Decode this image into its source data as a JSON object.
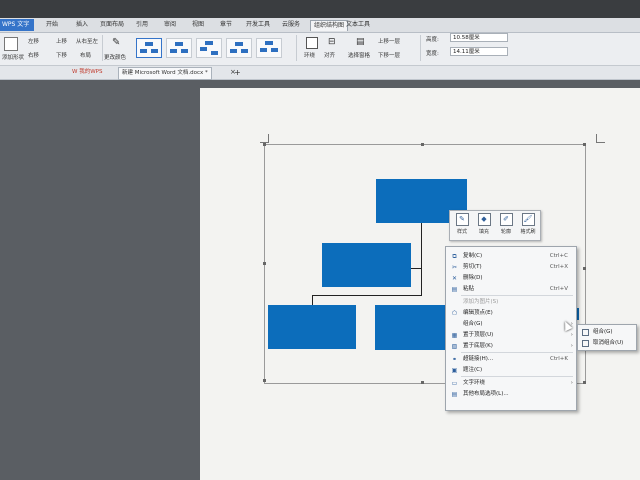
{
  "app": {
    "name": "WPS 文字"
  },
  "tabs": [
    "开始",
    "插入",
    "页面布局",
    "引用",
    "审阅",
    "视图",
    "章节",
    "开发工具",
    "云服务",
    "组织结构图",
    "文本工具"
  ],
  "active_tab": "组织结构图",
  "ribbon": {
    "add_shape": "添加形状",
    "left_shift": "左移",
    "right_shift": "右移",
    "up_shift": "上移",
    "down_shift": "下移",
    "vertical_layout": "从右至左",
    "layout": "布局",
    "change_color": "更改颜色",
    "surround": "环绕",
    "align": "对齐",
    "select_pane": "选择窗格",
    "bring_forward": "上移一层",
    "send_backward": "下移一层",
    "height_label": "高度:",
    "height_value": "10.58厘米",
    "width_label": "宽度:",
    "width_value": "14.11厘米"
  },
  "doc_tabs": {
    "home": "我的WPS",
    "doc": "新建 Microsoft Word 文档.docx *",
    "add": "+"
  },
  "mini_toolbar": [
    "样式",
    "填充",
    "轮廓",
    "格式刷"
  ],
  "context_menu": [
    {
      "label": "复制(C)",
      "shortcut": "Ctrl+C",
      "icon": "copy-icon",
      "glyph": "⧉"
    },
    {
      "label": "剪切(T)",
      "shortcut": "Ctrl+X",
      "icon": "cut-icon",
      "glyph": "✂"
    },
    {
      "label": "删除(D)",
      "shortcut": "",
      "icon": "delete-icon",
      "glyph": "✕"
    },
    {
      "label": "粘贴",
      "shortcut": "Ctrl+V",
      "icon": "paste-icon",
      "glyph": "▤"
    },
    {
      "label": "添加为图片(S)",
      "shortcut": "",
      "icon": "",
      "glyph": ""
    },
    {
      "label": "编辑顶点(E)",
      "shortcut": "",
      "icon": "edit-points-icon",
      "glyph": "⬠"
    },
    {
      "label": "组合(G)",
      "shortcut": "",
      "icon": "",
      "glyph": "",
      "submenu": true
    },
    {
      "label": "置于顶层(U)",
      "shortcut": "",
      "icon": "bring-front-icon",
      "glyph": "▦",
      "submenu": true
    },
    {
      "label": "置于底层(K)",
      "shortcut": "",
      "icon": "send-back-icon",
      "glyph": "▧",
      "submenu": true
    },
    {
      "label": "超链接(H)...",
      "shortcut": "Ctrl+K",
      "icon": "hyperlink-icon",
      "glyph": "⚭"
    },
    {
      "label": "题注(C)",
      "shortcut": "",
      "icon": "caption-icon",
      "glyph": "▣"
    },
    {
      "label": "文字环绕",
      "shortcut": "",
      "icon": "wrap-icon",
      "glyph": "▭",
      "submenu": true
    },
    {
      "label": "其他布局选项(L)...",
      "shortcut": "",
      "icon": "layout-options-icon",
      "glyph": "▤"
    }
  ],
  "submenu": [
    "组合(G)",
    "取消组合(U)"
  ],
  "colors": {
    "shape_fill": "#0c6dbb",
    "ribbon_accent": "#3574c9"
  }
}
